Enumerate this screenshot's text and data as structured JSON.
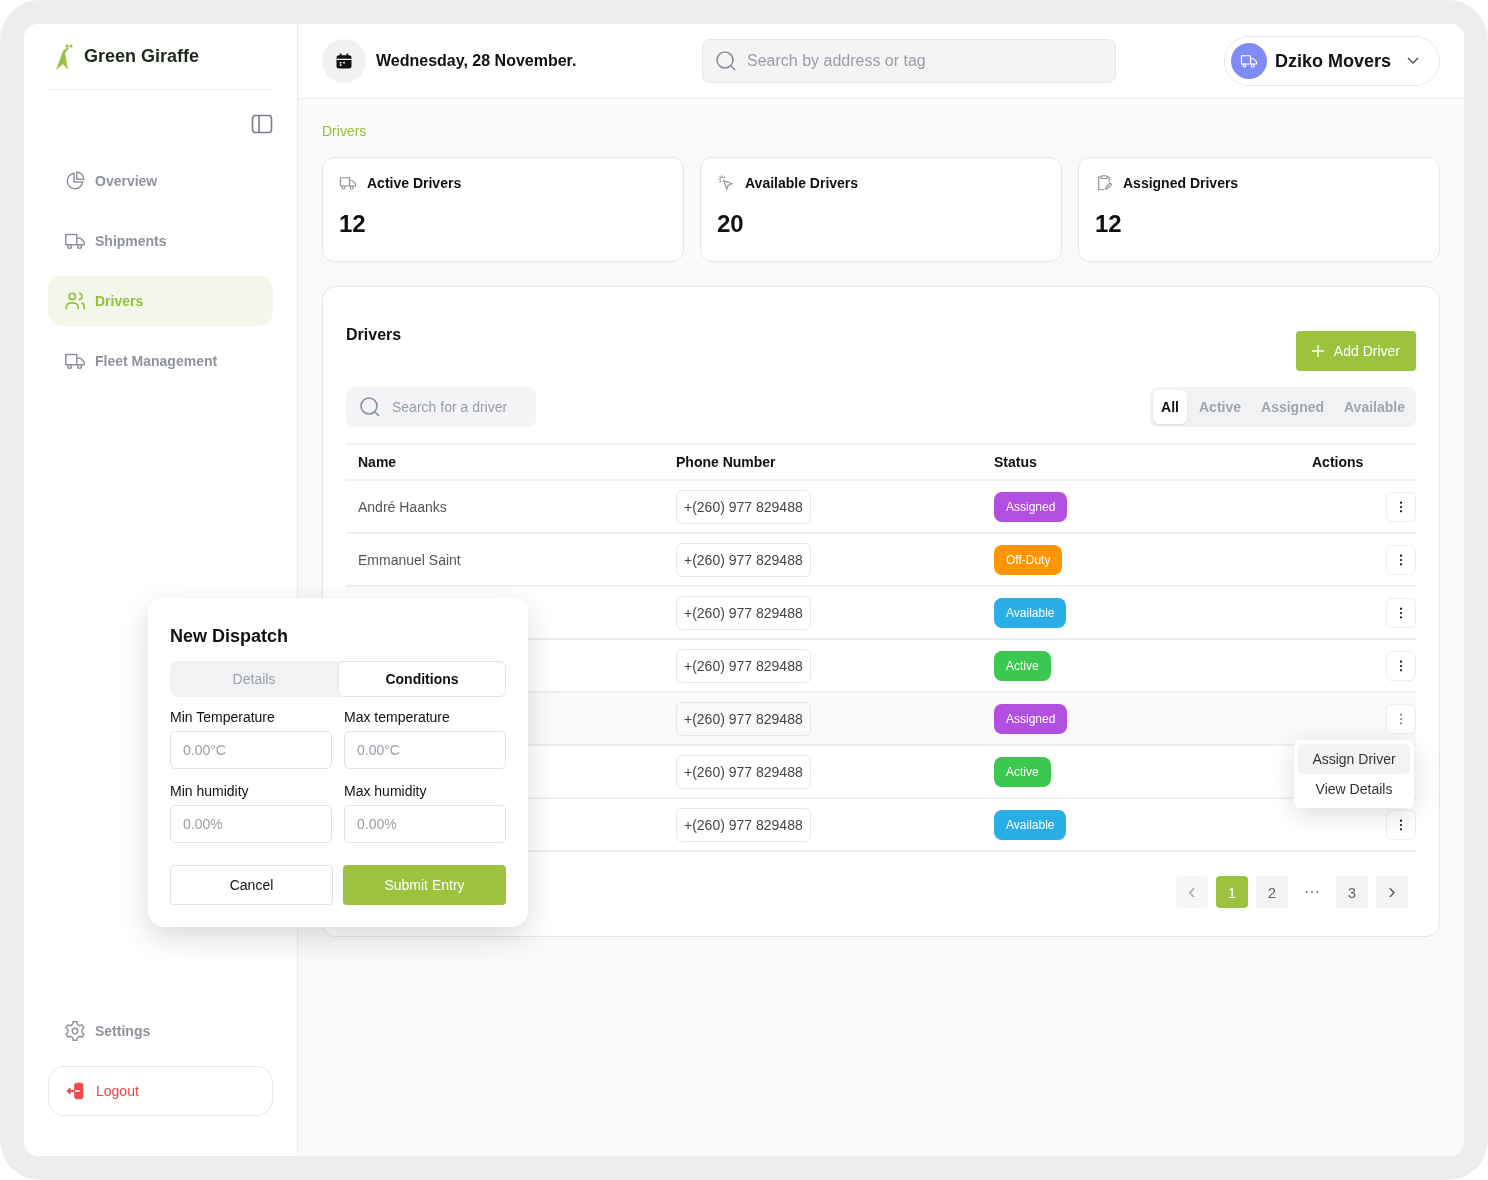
{
  "brand": {
    "name": "Green Giraffe"
  },
  "sidebar": {
    "items": [
      {
        "label": "Overview",
        "selected": false
      },
      {
        "label": "Shipments",
        "selected": false
      },
      {
        "label": "Drivers",
        "selected": true
      },
      {
        "label": "Fleet Management",
        "selected": false
      }
    ],
    "settings": "Settings",
    "logout": "Logout"
  },
  "header": {
    "date": "Wednesday, 28 November.",
    "search": {
      "placeholder": "Search by address or tag"
    },
    "account": "Dziko Movers"
  },
  "breadcrumb": "Drivers",
  "stats": [
    {
      "label": "Active Drivers",
      "value": "12"
    },
    {
      "label": "Available Drivers",
      "value": "20"
    },
    {
      "label": "Assigned Drivers",
      "value": "12"
    }
  ],
  "drivers": {
    "title": "Drivers",
    "add_button": "Add Driver",
    "search": {
      "placeholder": "Search for a driver"
    },
    "filters": [
      {
        "label": "All",
        "selected": true
      },
      {
        "label": "Active",
        "selected": false
      },
      {
        "label": "Assigned",
        "selected": false
      },
      {
        "label": "Available",
        "selected": false
      }
    ],
    "columns": [
      "Name",
      "Phone Number",
      "Status",
      "Actions"
    ],
    "rows": [
      {
        "name": "André Haanks",
        "phone": "+(260) 977 829488",
        "status": "Assigned",
        "color": "#b24fe0",
        "menu_open": false
      },
      {
        "name": "Emmanuel Saint",
        "phone": "+(260) 977 829488",
        "status": "Off-Duty",
        "color": "#ff9500",
        "menu_open": false
      },
      {
        "phone": "+(260) 977 829488",
        "status": "Available",
        "color": "#2aaee6",
        "menu_open": false
      },
      {
        "phone": "+(260) 977 829488",
        "status": "Active",
        "color": "#3cc751",
        "menu_open": false
      },
      {
        "phone": "+(260) 977 829488",
        "status": "Assigned",
        "color": "#b24fe0",
        "menu_open": true
      },
      {
        "phone": "+(260) 977 829488",
        "status": "Active",
        "color": "#3cc751",
        "menu_open": false
      },
      {
        "phone": "+(260) 977 829488",
        "status": "Available",
        "color": "#2aaee6",
        "menu_open": false
      }
    ],
    "menu": [
      {
        "label": "Assign Driver",
        "selected": true
      },
      {
        "label": "View Details",
        "selected": false
      }
    ],
    "pagination": [
      {
        "label": "‹",
        "kind": "prev",
        "disabled": true
      },
      {
        "label": "1",
        "kind": "page",
        "selected": true
      },
      {
        "label": "2",
        "kind": "page",
        "selected": false
      },
      {
        "label": "···",
        "kind": "gap"
      },
      {
        "label": "3",
        "kind": "page",
        "selected": false
      },
      {
        "label": "›",
        "kind": "next",
        "disabled": false
      }
    ]
  },
  "dialog": {
    "title": "New Dispatch",
    "tabs": [
      {
        "label": "Details",
        "selected": false
      },
      {
        "label": "Conditions",
        "selected": true
      }
    ],
    "fields": [
      {
        "label": "Min Temperature",
        "placeholder": "0.00°C"
      },
      {
        "label": "Max temperature",
        "placeholder": "0.00°C"
      },
      {
        "label": "Min humidity",
        "placeholder": "0.00%"
      },
      {
        "label": "Max humidity",
        "placeholder": "0.00%"
      }
    ],
    "cancel": "Cancel",
    "submit": "Submit Entry"
  }
}
